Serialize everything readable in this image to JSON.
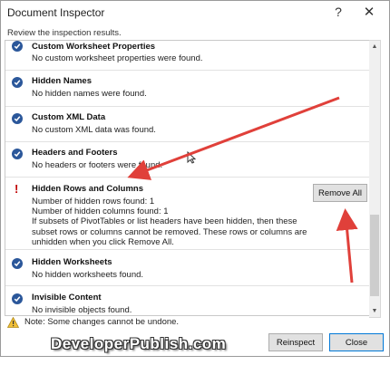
{
  "window": {
    "title": "Document Inspector",
    "help_symbol": "?",
    "close_symbol": "✕"
  },
  "subtitle": "Review the inspection results.",
  "items": [
    {
      "name": "Custom Worksheet Properties",
      "lines": [
        "No custom worksheet properties were found."
      ],
      "status": "ok"
    },
    {
      "name": "Hidden Names",
      "lines": [
        "No hidden names were found."
      ],
      "status": "ok"
    },
    {
      "name": "Custom XML Data",
      "lines": [
        "No custom XML data was found."
      ],
      "status": "ok"
    },
    {
      "name": "Headers and Footers",
      "lines": [
        "No headers or footers were found."
      ],
      "status": "ok"
    },
    {
      "name": "Hidden Rows and Columns",
      "lines": [
        "Number of hidden rows found: 1",
        "Number of hidden columns found: 1",
        "If subsets of PivotTables or list headers have been hidden, then these subset rows or columns cannot be removed. These rows or columns are unhidden when you click Remove All."
      ],
      "status": "warning",
      "warning_symbol": "!",
      "action_label": "Remove All"
    },
    {
      "name": "Hidden Worksheets",
      "lines": [
        "No hidden worksheets found."
      ],
      "status": "ok"
    },
    {
      "name": "Invisible Content",
      "lines": [
        "No invisible objects found."
      ],
      "status": "ok"
    }
  ],
  "footer": {
    "note": "Note: Some changes cannot be undone.",
    "reinspect_label": "Reinspect",
    "close_label": "Close"
  },
  "watermark": "DeveloperPublish.com",
  "colors": {
    "check_icon": "#2b579a",
    "warning": "#c00000",
    "annotation_arrow": "#e0403a"
  }
}
